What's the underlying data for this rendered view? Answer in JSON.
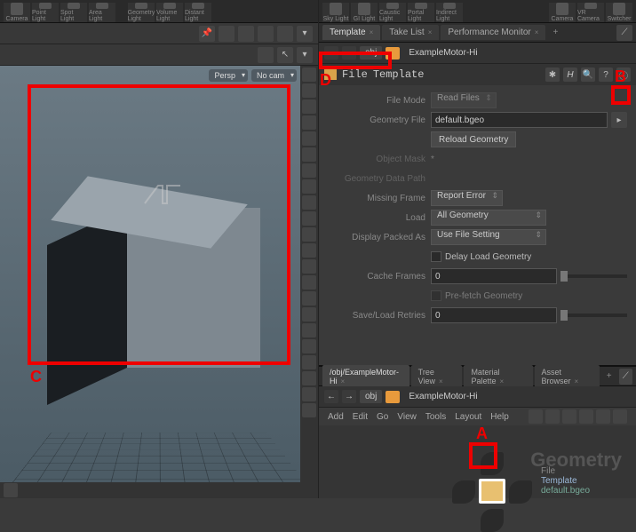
{
  "shelf": {
    "left_items": [
      "Camera",
      "Point Light",
      "Spot Light",
      "Area Light"
    ],
    "left_items2": [
      "Geometry Light",
      "Volume Light",
      "Distant Light"
    ],
    "right_items": [
      "Sky Light",
      "GI Light",
      "Caustic Light",
      "Portal Light",
      "Indirect Light",
      "Camera",
      "VR Camera",
      "Switcher"
    ]
  },
  "left": {
    "viewport": {
      "persp_menu": "Persp",
      "cam_menu": "No cam"
    }
  },
  "callouts": {
    "A": "A",
    "B": "B",
    "C": "C",
    "D": "D"
  },
  "right_upper": {
    "tabs": [
      "Template",
      "Take List",
      "Performance Monitor"
    ],
    "path": {
      "level": "obj",
      "node": "ExampleMotor-Hi"
    },
    "node_header": {
      "type": "File",
      "name": "Template"
    },
    "icons": {
      "gear": "settings-icon",
      "H": "H",
      "search": "search-icon",
      "help": "?",
      "info": "ⓘ"
    },
    "params": {
      "file_mode_label": "File Mode",
      "file_mode_value": "Read Files",
      "geometry_file_label": "Geometry File",
      "geometry_file_value": "default.bgeo",
      "reload_label": "Reload Geometry",
      "object_mask_label": "Object Mask",
      "object_mask_value": "*",
      "geometry_data_path_label": "Geometry Data Path",
      "missing_frame_label": "Missing Frame",
      "missing_frame_value": "Report Error",
      "load_label": "Load",
      "load_value": "All Geometry",
      "display_packed_label": "Display Packed As",
      "display_packed_value": "Use File Setting",
      "delay_load_label": "Delay Load Geometry",
      "cache_frames_label": "Cache Frames",
      "cache_frames_value": "0",
      "prefetch_label": "Pre-fetch Geometry",
      "retries_label": "Save/Load Retries",
      "retries_value": "0"
    }
  },
  "right_lower": {
    "tabs": [
      "/obj/ExampleMotor-Hi",
      "Tree View",
      "Material Palette",
      "Asset Browser"
    ],
    "path": {
      "level": "obj",
      "node": "ExampleMotor-Hi"
    },
    "menu": [
      "Add",
      "Edit",
      "Go",
      "View",
      "Tools",
      "Layout",
      "Help"
    ],
    "bg_label": "Geometry",
    "node": {
      "type": "File",
      "name": "Template",
      "file": "default.bgeo"
    }
  }
}
